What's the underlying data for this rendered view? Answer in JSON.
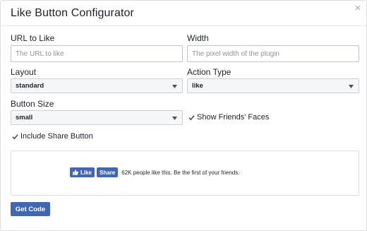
{
  "dialog": {
    "title": "Like Button Configurator"
  },
  "form": {
    "url": {
      "label": "URL to Like",
      "value": "",
      "placeholder": "The URL to like"
    },
    "width": {
      "label": "Width",
      "value": "",
      "placeholder": "The pixel width of the plugin"
    },
    "layout": {
      "label": "Layout",
      "selected": "standard"
    },
    "action_type": {
      "label": "Action Type",
      "selected": "like"
    },
    "button_size": {
      "label": "Button Size",
      "selected": "small"
    },
    "show_friends_faces": {
      "label": "Show Friends' Faces",
      "checked": true
    },
    "include_share": {
      "label": "Include Share Button",
      "checked": true
    }
  },
  "preview": {
    "like_label": "Like",
    "share_label": "Share",
    "social_text": "62K people like this. Be the first of your friends."
  },
  "actions": {
    "get_code_label": "Get Code"
  },
  "colors": {
    "brand_blue": "#4267b2",
    "text": "#1d2129",
    "placeholder": "#90949c"
  }
}
